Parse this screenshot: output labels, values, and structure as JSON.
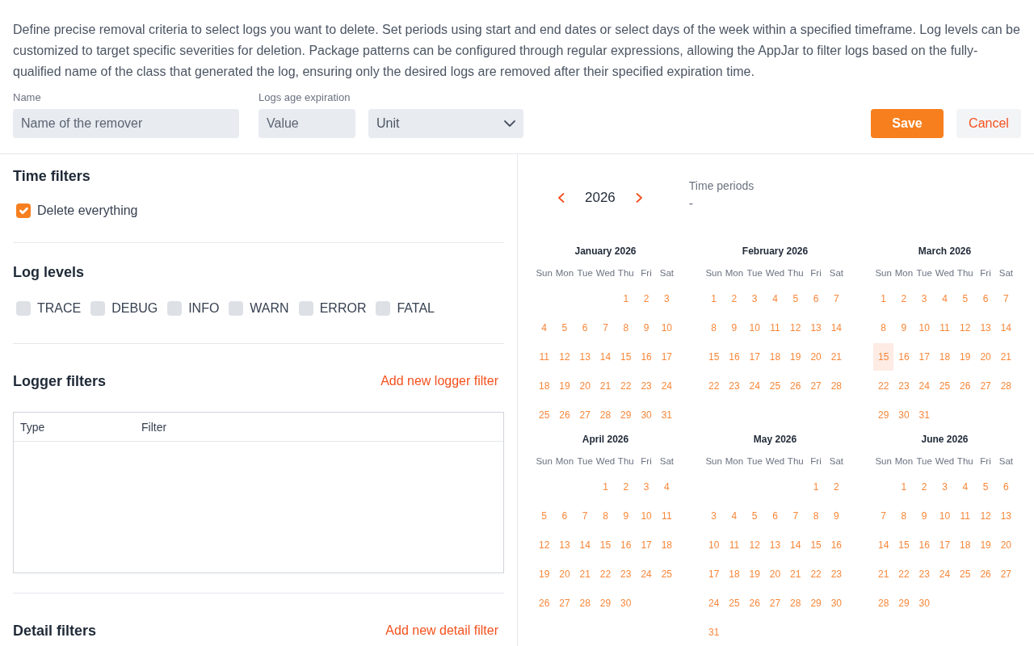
{
  "description": "Define precise removal criteria to select logs you want to delete. Set periods using start and end dates or select days of the week within a specified timeframe. Log levels can be customized to target specific severities for deletion. Package patterns can be configured through regular expressions, allowing the AppJar to filter logs based on the fully-qualified name of the class that generated the log, ensuring only the desired logs are removed after their specified expiration time.",
  "form": {
    "name": {
      "label": "Name",
      "placeholder": "Name of the remover"
    },
    "expiration": {
      "label": "Logs age expiration",
      "value_placeholder": "Value",
      "unit_placeholder": "Unit"
    }
  },
  "buttons": [
    {
      "label": "Save",
      "kind": "primary"
    },
    {
      "label": "Cancel",
      "kind": "secondary"
    }
  ],
  "time_filters": {
    "title": "Time filters",
    "options": [
      {
        "label": "Delete everything",
        "checked": true
      }
    ]
  },
  "log_levels": {
    "title": "Log levels",
    "levels": [
      {
        "label": "TRACE",
        "checked": false
      },
      {
        "label": "DEBUG",
        "checked": false
      },
      {
        "label": "INFO",
        "checked": false
      },
      {
        "label": "WARN",
        "checked": false
      },
      {
        "label": "ERROR",
        "checked": false
      },
      {
        "label": "FATAL",
        "checked": false
      }
    ]
  },
  "logger_filters": {
    "title": "Logger filters",
    "add_link": "Add new logger filter",
    "table": {
      "columns": [
        "Type",
        "Filter"
      ]
    }
  },
  "detail_filters": {
    "title": "Detail filters",
    "add_link": "Add new detail filter"
  },
  "calendar": {
    "year": "2026",
    "time_periods": {
      "label": "Time periods",
      "value": "-"
    },
    "months": [
      {
        "title": "January 2026",
        "weekdays": [
          "Sun",
          "Mon",
          "Tue",
          "Wed",
          "Thu",
          "Fri",
          "Sat"
        ],
        "weeks": [
          [
            {
              "day": "1",
              "today": false
            },
            {
              "day": "2",
              "today": false
            },
            {
              "day": "3",
              "today": false
            }
          ],
          [
            {
              "day": "4",
              "today": false
            },
            {
              "day": "5",
              "today": false
            },
            {
              "day": "6",
              "today": false
            },
            {
              "day": "7",
              "today": false
            },
            {
              "day": "8",
              "today": false
            },
            {
              "day": "9",
              "today": false
            },
            {
              "day": "10",
              "today": false
            }
          ],
          [
            {
              "day": "11",
              "today": false
            },
            {
              "day": "12",
              "today": false
            },
            {
              "day": "13",
              "today": false
            },
            {
              "day": "14",
              "today": false
            },
            {
              "day": "15",
              "today": false
            },
            {
              "day": "16",
              "today": false
            },
            {
              "day": "17",
              "today": false
            }
          ],
          [
            {
              "day": "18",
              "today": false
            },
            {
              "day": "19",
              "today": false
            },
            {
              "day": "20",
              "today": false
            },
            {
              "day": "21",
              "today": false
            },
            {
              "day": "22",
              "today": false
            },
            {
              "day": "23",
              "today": false
            },
            {
              "day": "24",
              "today": false
            }
          ],
          [
            {
              "day": "25",
              "today": false
            },
            {
              "day": "26",
              "today": false
            },
            {
              "day": "27",
              "today": false
            },
            {
              "day": "28",
              "today": false
            },
            {
              "day": "29",
              "today": false
            },
            {
              "day": "30",
              "today": false
            },
            {
              "day": "31",
              "today": false
            }
          ]
        ]
      },
      {
        "title": "February 2026",
        "weekdays": [
          "Sun",
          "Mon",
          "Tue",
          "Wed",
          "Thu",
          "Fri",
          "Sat"
        ],
        "weeks": [
          [
            {
              "day": "1",
              "today": false
            },
            {
              "day": "2",
              "today": false
            },
            {
              "day": "3",
              "today": false
            },
            {
              "day": "4",
              "today": false
            },
            {
              "day": "5",
              "today": false
            },
            {
              "day": "6",
              "today": false
            },
            {
              "day": "7",
              "today": false
            }
          ],
          [
            {
              "day": "8",
              "today": false
            },
            {
              "day": "9",
              "today": false
            },
            {
              "day": "10",
              "today": false
            },
            {
              "day": "11",
              "today": false
            },
            {
              "day": "12",
              "today": false
            },
            {
              "day": "13",
              "today": false
            },
            {
              "day": "14",
              "today": false
            }
          ],
          [
            {
              "day": "15",
              "today": false
            },
            {
              "day": "16",
              "today": false
            },
            {
              "day": "17",
              "today": false
            },
            {
              "day": "18",
              "today": false
            },
            {
              "day": "19",
              "today": false
            },
            {
              "day": "20",
              "today": false
            },
            {
              "day": "21",
              "today": false
            }
          ],
          [
            {
              "day": "22",
              "today": false
            },
            {
              "day": "23",
              "today": false
            },
            {
              "day": "24",
              "today": false
            },
            {
              "day": "25",
              "today": false
            },
            {
              "day": "26",
              "today": false
            },
            {
              "day": "27",
              "today": false
            },
            {
              "day": "28",
              "today": false
            }
          ]
        ]
      },
      {
        "title": "March 2026",
        "weekdays": [
          "Sun",
          "Mon",
          "Tue",
          "Wed",
          "Thu",
          "Fri",
          "Sat"
        ],
        "weeks": [
          [
            {
              "day": "1",
              "today": false
            },
            {
              "day": "2",
              "today": false
            },
            {
              "day": "3",
              "today": false
            },
            {
              "day": "4",
              "today": false
            },
            {
              "day": "5",
              "today": false
            },
            {
              "day": "6",
              "today": false
            },
            {
              "day": "7",
              "today": false
            }
          ],
          [
            {
              "day": "8",
              "today": false
            },
            {
              "day": "9",
              "today": false
            },
            {
              "day": "10",
              "today": false
            },
            {
              "day": "11",
              "today": false
            },
            {
              "day": "12",
              "today": false
            },
            {
              "day": "13",
              "today": false
            },
            {
              "day": "14",
              "today": false
            }
          ],
          [
            {
              "day": "15",
              "today": true
            },
            {
              "day": "16",
              "today": false
            },
            {
              "day": "17",
              "today": false
            },
            {
              "day": "18",
              "today": false
            },
            {
              "day": "19",
              "today": false
            },
            {
              "day": "20",
              "today": false
            },
            {
              "day": "21",
              "today": false
            }
          ],
          [
            {
              "day": "22",
              "today": false
            },
            {
              "day": "23",
              "today": false
            },
            {
              "day": "24",
              "today": false
            },
            {
              "day": "25",
              "today": false
            },
            {
              "day": "26",
              "today": false
            },
            {
              "day": "27",
              "today": false
            },
            {
              "day": "28",
              "today": false
            }
          ],
          [
            {
              "day": "29",
              "today": false
            },
            {
              "day": "30",
              "today": false
            },
            {
              "day": "31",
              "today": false
            }
          ]
        ]
      },
      {
        "title": "April 2026",
        "weekdays": [
          "Sun",
          "Mon",
          "Tue",
          "Wed",
          "Thu",
          "Fri",
          "Sat"
        ],
        "weeks": [
          [
            {
              "day": "1",
              "today": false
            },
            {
              "day": "2",
              "today": false
            },
            {
              "day": "3",
              "today": false
            },
            {
              "day": "4",
              "today": false
            }
          ],
          [
            {
              "day": "5",
              "today": false
            },
            {
              "day": "6",
              "today": false
            },
            {
              "day": "7",
              "today": false
            },
            {
              "day": "8",
              "today": false
            },
            {
              "day": "9",
              "today": false
            },
            {
              "day": "10",
              "today": false
            },
            {
              "day": "11",
              "today": false
            }
          ],
          [
            {
              "day": "12",
              "today": false
            },
            {
              "day": "13",
              "today": false
            },
            {
              "day": "14",
              "today": false
            },
            {
              "day": "15",
              "today": false
            },
            {
              "day": "16",
              "today": false
            },
            {
              "day": "17",
              "today": false
            },
            {
              "day": "18",
              "today": false
            }
          ],
          [
            {
              "day": "19",
              "today": false
            },
            {
              "day": "20",
              "today": false
            },
            {
              "day": "21",
              "today": false
            },
            {
              "day": "22",
              "today": false
            },
            {
              "day": "23",
              "today": false
            },
            {
              "day": "24",
              "today": false
            },
            {
              "day": "25",
              "today": false
            }
          ],
          [
            {
              "day": "26",
              "today": false
            },
            {
              "day": "27",
              "today": false
            },
            {
              "day": "28",
              "today": false
            },
            {
              "day": "29",
              "today": false
            },
            {
              "day": "30",
              "today": false
            }
          ]
        ]
      },
      {
        "title": "May 2026",
        "weekdays": [
          "Sun",
          "Mon",
          "Tue",
          "Wed",
          "Thu",
          "Fri",
          "Sat"
        ],
        "weeks": [
          [
            {
              "day": "1",
              "today": false
            },
            {
              "day": "2",
              "today": false
            }
          ],
          [
            {
              "day": "3",
              "today": false
            },
            {
              "day": "4",
              "today": false
            },
            {
              "day": "5",
              "today": false
            },
            {
              "day": "6",
              "today": false
            },
            {
              "day": "7",
              "today": false
            },
            {
              "day": "8",
              "today": false
            },
            {
              "day": "9",
              "today": false
            }
          ],
          [
            {
              "day": "10",
              "today": false
            },
            {
              "day": "11",
              "today": false
            },
            {
              "day": "12",
              "today": false
            },
            {
              "day": "13",
              "today": false
            },
            {
              "day": "14",
              "today": false
            },
            {
              "day": "15",
              "today": false
            },
            {
              "day": "16",
              "today": false
            }
          ],
          [
            {
              "day": "17",
              "today": false
            },
            {
              "day": "18",
              "today": false
            },
            {
              "day": "19",
              "today": false
            },
            {
              "day": "20",
              "today": false
            },
            {
              "day": "21",
              "today": false
            },
            {
              "day": "22",
              "today": false
            },
            {
              "day": "23",
              "today": false
            }
          ],
          [
            {
              "day": "24",
              "today": false
            },
            {
              "day": "25",
              "today": false
            },
            {
              "day": "26",
              "today": false
            },
            {
              "day": "27",
              "today": false
            },
            {
              "day": "28",
              "today": false
            },
            {
              "day": "29",
              "today": false
            },
            {
              "day": "30",
              "today": false
            }
          ],
          [
            {
              "day": "31",
              "today": false
            }
          ]
        ]
      },
      {
        "title": "June 2026",
        "weekdays": [
          "Sun",
          "Mon",
          "Tue",
          "Wed",
          "Thu",
          "Fri",
          "Sat"
        ],
        "weeks": [
          [
            {
              "day": "1",
              "today": false
            },
            {
              "day": "2",
              "today": false
            },
            {
              "day": "3",
              "today": false
            },
            {
              "day": "4",
              "today": false
            },
            {
              "day": "5",
              "today": false
            },
            {
              "day": "6",
              "today": false
            }
          ],
          [
            {
              "day": "7",
              "today": false
            },
            {
              "day": "8",
              "today": false
            },
            {
              "day": "9",
              "today": false
            },
            {
              "day": "10",
              "today": false
            },
            {
              "day": "11",
              "today": false
            },
            {
              "day": "12",
              "today": false
            },
            {
              "day": "13",
              "today": false
            }
          ],
          [
            {
              "day": "14",
              "today": false
            },
            {
              "day": "15",
              "today": false
            },
            {
              "day": "16",
              "today": false
            },
            {
              "day": "17",
              "today": false
            },
            {
              "day": "18",
              "today": false
            },
            {
              "day": "19",
              "today": false
            },
            {
              "day": "20",
              "today": false
            }
          ],
          [
            {
              "day": "21",
              "today": false
            },
            {
              "day": "22",
              "today": false
            },
            {
              "day": "23",
              "today": false
            },
            {
              "day": "24",
              "today": false
            },
            {
              "day": "25",
              "today": false
            },
            {
              "day": "26",
              "today": false
            },
            {
              "day": "27",
              "today": false
            }
          ],
          [
            {
              "day": "28",
              "today": false
            },
            {
              "day": "29",
              "today": false
            },
            {
              "day": "30",
              "today": false
            }
          ]
        ]
      }
    ]
  }
}
